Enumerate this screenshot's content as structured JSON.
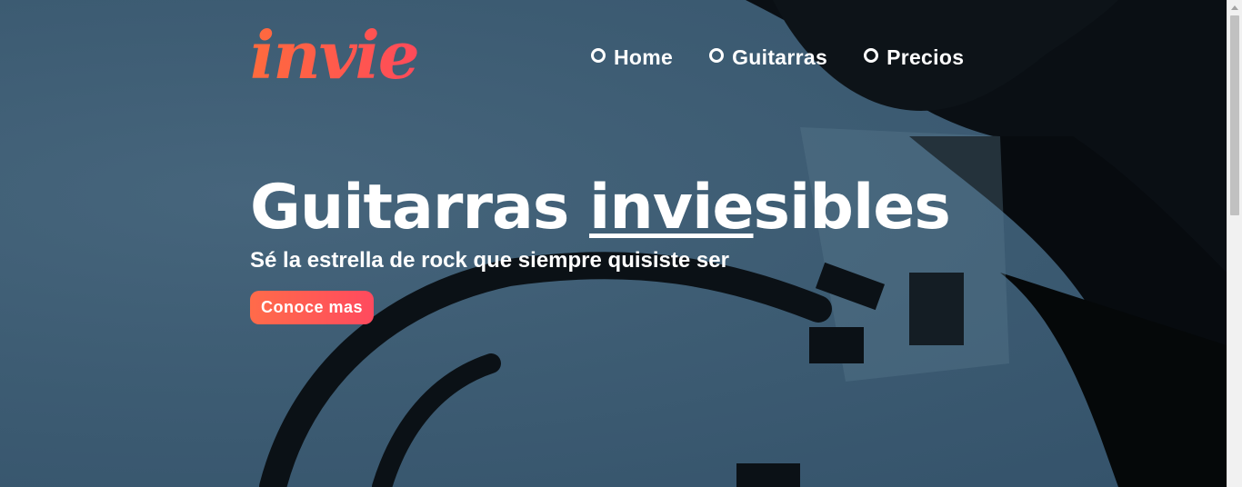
{
  "brand": {
    "logo_text": "invie"
  },
  "nav": {
    "items": [
      {
        "label": "Home"
      },
      {
        "label": "Guitarras"
      },
      {
        "label": "Precios"
      }
    ]
  },
  "hero": {
    "headline_start": "Guitarras ",
    "headline_underlined": "invie",
    "headline_end": "sibles",
    "subtitle": "Sé la estrella de rock que siempre quisiste ser",
    "cta_label": "Conoce mas"
  },
  "colors": {
    "background": "#3d5c73",
    "accent_start": "#ff6b3d",
    "accent_end": "#ff4a5a",
    "text": "#ffffff"
  }
}
